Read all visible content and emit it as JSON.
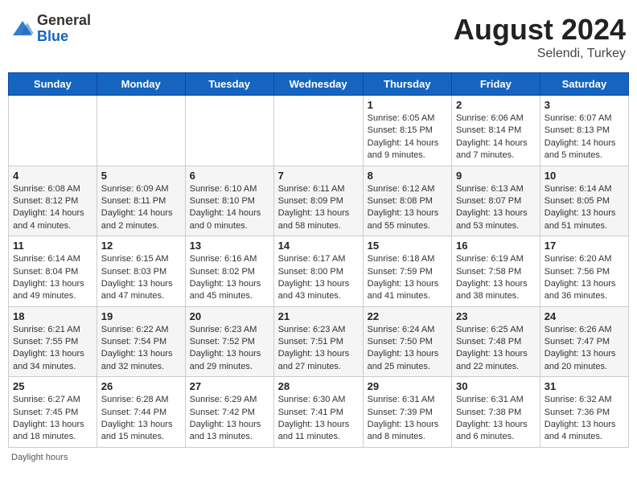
{
  "header": {
    "logo_general": "General",
    "logo_blue": "Blue",
    "month_year": "August 2024",
    "location": "Selendi, Turkey"
  },
  "weekdays": [
    "Sunday",
    "Monday",
    "Tuesday",
    "Wednesday",
    "Thursday",
    "Friday",
    "Saturday"
  ],
  "footer": "Daylight hours",
  "weeks": [
    [
      {
        "day": "",
        "info": ""
      },
      {
        "day": "",
        "info": ""
      },
      {
        "day": "",
        "info": ""
      },
      {
        "day": "",
        "info": ""
      },
      {
        "day": "1",
        "info": "Sunrise: 6:05 AM\nSunset: 8:15 PM\nDaylight: 14 hours and 9 minutes."
      },
      {
        "day": "2",
        "info": "Sunrise: 6:06 AM\nSunset: 8:14 PM\nDaylight: 14 hours and 7 minutes."
      },
      {
        "day": "3",
        "info": "Sunrise: 6:07 AM\nSunset: 8:13 PM\nDaylight: 14 hours and 5 minutes."
      }
    ],
    [
      {
        "day": "4",
        "info": "Sunrise: 6:08 AM\nSunset: 8:12 PM\nDaylight: 14 hours and 4 minutes."
      },
      {
        "day": "5",
        "info": "Sunrise: 6:09 AM\nSunset: 8:11 PM\nDaylight: 14 hours and 2 minutes."
      },
      {
        "day": "6",
        "info": "Sunrise: 6:10 AM\nSunset: 8:10 PM\nDaylight: 14 hours and 0 minutes."
      },
      {
        "day": "7",
        "info": "Sunrise: 6:11 AM\nSunset: 8:09 PM\nDaylight: 13 hours and 58 minutes."
      },
      {
        "day": "8",
        "info": "Sunrise: 6:12 AM\nSunset: 8:08 PM\nDaylight: 13 hours and 55 minutes."
      },
      {
        "day": "9",
        "info": "Sunrise: 6:13 AM\nSunset: 8:07 PM\nDaylight: 13 hours and 53 minutes."
      },
      {
        "day": "10",
        "info": "Sunrise: 6:14 AM\nSunset: 8:05 PM\nDaylight: 13 hours and 51 minutes."
      }
    ],
    [
      {
        "day": "11",
        "info": "Sunrise: 6:14 AM\nSunset: 8:04 PM\nDaylight: 13 hours and 49 minutes."
      },
      {
        "day": "12",
        "info": "Sunrise: 6:15 AM\nSunset: 8:03 PM\nDaylight: 13 hours and 47 minutes."
      },
      {
        "day": "13",
        "info": "Sunrise: 6:16 AM\nSunset: 8:02 PM\nDaylight: 13 hours and 45 minutes."
      },
      {
        "day": "14",
        "info": "Sunrise: 6:17 AM\nSunset: 8:00 PM\nDaylight: 13 hours and 43 minutes."
      },
      {
        "day": "15",
        "info": "Sunrise: 6:18 AM\nSunset: 7:59 PM\nDaylight: 13 hours and 41 minutes."
      },
      {
        "day": "16",
        "info": "Sunrise: 6:19 AM\nSunset: 7:58 PM\nDaylight: 13 hours and 38 minutes."
      },
      {
        "day": "17",
        "info": "Sunrise: 6:20 AM\nSunset: 7:56 PM\nDaylight: 13 hours and 36 minutes."
      }
    ],
    [
      {
        "day": "18",
        "info": "Sunrise: 6:21 AM\nSunset: 7:55 PM\nDaylight: 13 hours and 34 minutes."
      },
      {
        "day": "19",
        "info": "Sunrise: 6:22 AM\nSunset: 7:54 PM\nDaylight: 13 hours and 32 minutes."
      },
      {
        "day": "20",
        "info": "Sunrise: 6:23 AM\nSunset: 7:52 PM\nDaylight: 13 hours and 29 minutes."
      },
      {
        "day": "21",
        "info": "Sunrise: 6:23 AM\nSunset: 7:51 PM\nDaylight: 13 hours and 27 minutes."
      },
      {
        "day": "22",
        "info": "Sunrise: 6:24 AM\nSunset: 7:50 PM\nDaylight: 13 hours and 25 minutes."
      },
      {
        "day": "23",
        "info": "Sunrise: 6:25 AM\nSunset: 7:48 PM\nDaylight: 13 hours and 22 minutes."
      },
      {
        "day": "24",
        "info": "Sunrise: 6:26 AM\nSunset: 7:47 PM\nDaylight: 13 hours and 20 minutes."
      }
    ],
    [
      {
        "day": "25",
        "info": "Sunrise: 6:27 AM\nSunset: 7:45 PM\nDaylight: 13 hours and 18 minutes."
      },
      {
        "day": "26",
        "info": "Sunrise: 6:28 AM\nSunset: 7:44 PM\nDaylight: 13 hours and 15 minutes."
      },
      {
        "day": "27",
        "info": "Sunrise: 6:29 AM\nSunset: 7:42 PM\nDaylight: 13 hours and 13 minutes."
      },
      {
        "day": "28",
        "info": "Sunrise: 6:30 AM\nSunset: 7:41 PM\nDaylight: 13 hours and 11 minutes."
      },
      {
        "day": "29",
        "info": "Sunrise: 6:31 AM\nSunset: 7:39 PM\nDaylight: 13 hours and 8 minutes."
      },
      {
        "day": "30",
        "info": "Sunrise: 6:31 AM\nSunset: 7:38 PM\nDaylight: 13 hours and 6 minutes."
      },
      {
        "day": "31",
        "info": "Sunrise: 6:32 AM\nSunset: 7:36 PM\nDaylight: 13 hours and 4 minutes."
      }
    ]
  ]
}
